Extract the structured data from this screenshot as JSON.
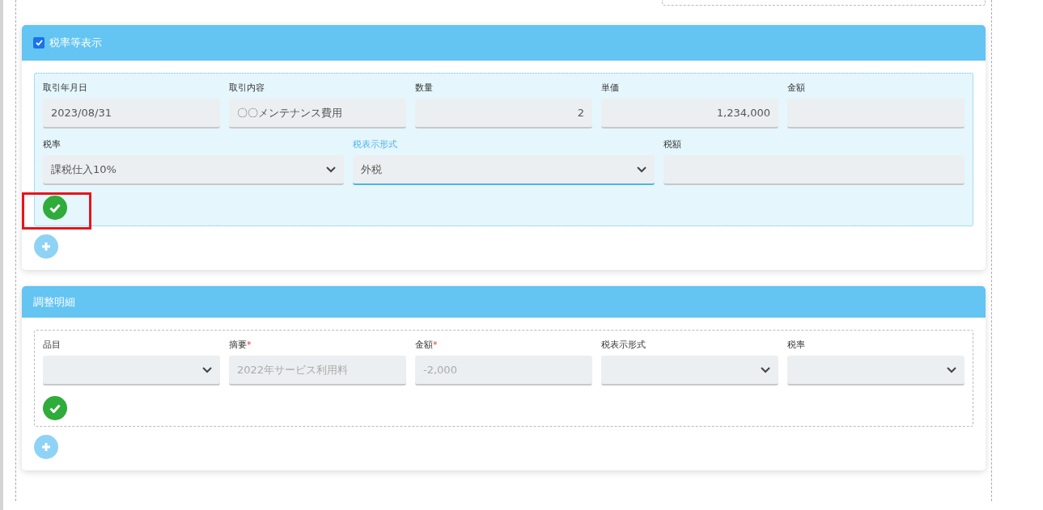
{
  "sections": [
    {
      "title": "税率等表示",
      "checkbox": {
        "checked": true
      },
      "kind": "highlight",
      "lines": [
        {
          "fields": [
            {
              "label": "取引年月日",
              "kind": "text",
              "value": "2023/08/31",
              "focused": false
            },
            {
              "label": "取引内容",
              "kind": "text",
              "value": "〇〇メンテナンス費用",
              "focused": false
            },
            {
              "label": "数量",
              "kind": "number",
              "value": "2",
              "focused": false
            },
            {
              "label": "単価",
              "kind": "number",
              "value": "1,234,000",
              "focused": false
            },
            {
              "label": "金額",
              "kind": "text",
              "focused": false
            }
          ]
        },
        {
          "fields": [
            {
              "label": "税率",
              "kind": "select",
              "value": "課税仕入10%",
              "focused": false
            },
            {
              "label": "税表示形式",
              "kind": "select",
              "value": "外税",
              "focused": true
            },
            {
              "label": "税額",
              "kind": "text",
              "focused": false
            }
          ]
        }
      ],
      "highlighted_confirm": true
    },
    {
      "title": "調整明細",
      "kind": "dashed",
      "lines": [
        {
          "fields": [
            {
              "label": "品目",
              "kind": "select",
              "focused": false
            },
            {
              "label": "摘要",
              "required_mark": "*",
              "kind": "text",
              "placeholder": "2022年サービス利用料",
              "focused": false
            },
            {
              "label": "金額",
              "required_mark": "*",
              "kind": "text",
              "placeholder": "-2,000",
              "focused": false
            },
            {
              "label": "税表示形式",
              "kind": "select",
              "focused": false
            },
            {
              "label": "税率",
              "kind": "select",
              "focused": false
            }
          ]
        }
      ]
    }
  ]
}
